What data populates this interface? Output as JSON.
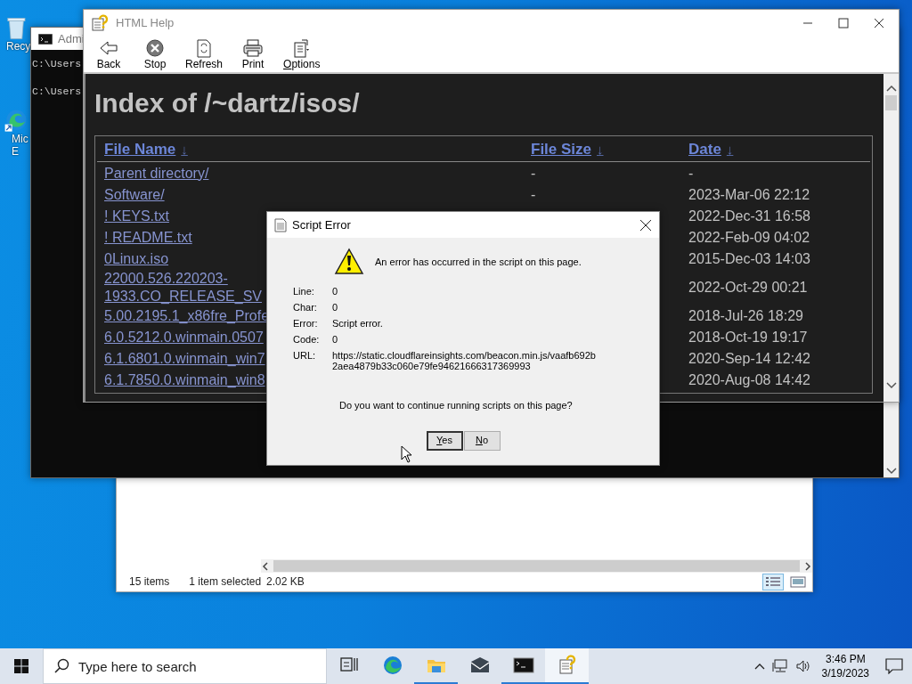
{
  "desktop_icons": [
    {
      "kind": "bin",
      "lines": [
        "Recy"
      ]
    },
    {
      "kind": "edge",
      "lines": [
        "Mic",
        "E"
      ]
    }
  ],
  "console": {
    "title": "Admi",
    "lines": [
      "C:\\Users",
      "C:\\Users"
    ]
  },
  "help_window": {
    "title": "HTML Help",
    "toolbar": [
      {
        "kind": "back",
        "label": "Back"
      },
      {
        "kind": "stop",
        "label": "Stop"
      },
      {
        "kind": "refresh",
        "label": "Refresh"
      },
      {
        "kind": "print",
        "label": "Print"
      },
      {
        "kind": "options",
        "label": "Options",
        "access_key_underlined": true
      }
    ],
    "heading": "Index of /~dartz/isos/",
    "columns": [
      {
        "label": "File Name",
        "sort": "↓"
      },
      {
        "label": "File Size",
        "sort": "↓"
      },
      {
        "label": "Date",
        "sort": "↓"
      }
    ],
    "rows": [
      {
        "name": "Parent directory/",
        "size": "-",
        "date": "-"
      },
      {
        "name": "Software/",
        "size": "-",
        "date": "2023-Mar-06 22:12"
      },
      {
        "name": "! KEYS.txt",
        "date": "2022-Dec-31 16:58"
      },
      {
        "name": "! README.txt",
        "date": "2022-Feb-09 04:02"
      },
      {
        "name": "0Linux.iso",
        "date": "2015-Dec-03 14:03"
      },
      {
        "name": "22000.526.220203-\n1933.CO_RELEASE_SV",
        "date": "2022-Oct-29 00:21"
      },
      {
        "name": "5.00.2195.1_x86fre_Profe",
        "date": "2018-Jul-26 18:29"
      },
      {
        "name": "6.0.5212.0.winmain.0507",
        "date": "2018-Oct-19 19:17"
      },
      {
        "name": "6.1.6801.0.winmain_win7",
        "date": "2020-Sep-14 12:42"
      },
      {
        "name": "6.1.7850.0.winmain_win8",
        "date": "2020-Aug-08 14:42"
      }
    ]
  },
  "dialog": {
    "title": "Script Error",
    "message": "An error has occurred in the script on this page.",
    "details": [
      {
        "label": "Line:",
        "value": "0"
      },
      {
        "label": "Char:",
        "value": "0"
      },
      {
        "label": "Error:",
        "value": "Script error."
      },
      {
        "label": "Code:",
        "value": "0"
      },
      {
        "label": "URL:",
        "value": "https://static.cloudflareinsights.com/beacon.min.js/vaafb692b\n2aea4879b33c060e79fe94621666317369993"
      }
    ],
    "question": "Do you want to continue running scripts on this page?",
    "buttons": [
      {
        "label": "Yes",
        "access_key_underlined": true,
        "default": true
      },
      {
        "label": "No",
        "access_key_underlined": true,
        "default": false
      }
    ]
  },
  "explorer": {
    "status": [
      "15 items",
      "1 item selected",
      "2.02 KB"
    ],
    "views": [
      {
        "kind": "details",
        "selected": true
      },
      {
        "kind": "large",
        "selected": false
      }
    ]
  },
  "taskbar": {
    "search": {
      "placeholder": "Type here to search"
    },
    "apps": [
      {
        "kind": "taskview",
        "running": false,
        "selected": false
      },
      {
        "kind": "edge",
        "running": false,
        "selected": false
      },
      {
        "kind": "folder",
        "running": true,
        "selected": false
      },
      {
        "kind": "mail",
        "running": false,
        "selected": false
      },
      {
        "kind": "console",
        "running": true,
        "selected": false
      },
      {
        "kind": "help",
        "running": true,
        "selected": true
      }
    ],
    "clock": {
      "time": "3:46 PM",
      "date": "3/19/2023"
    }
  }
}
